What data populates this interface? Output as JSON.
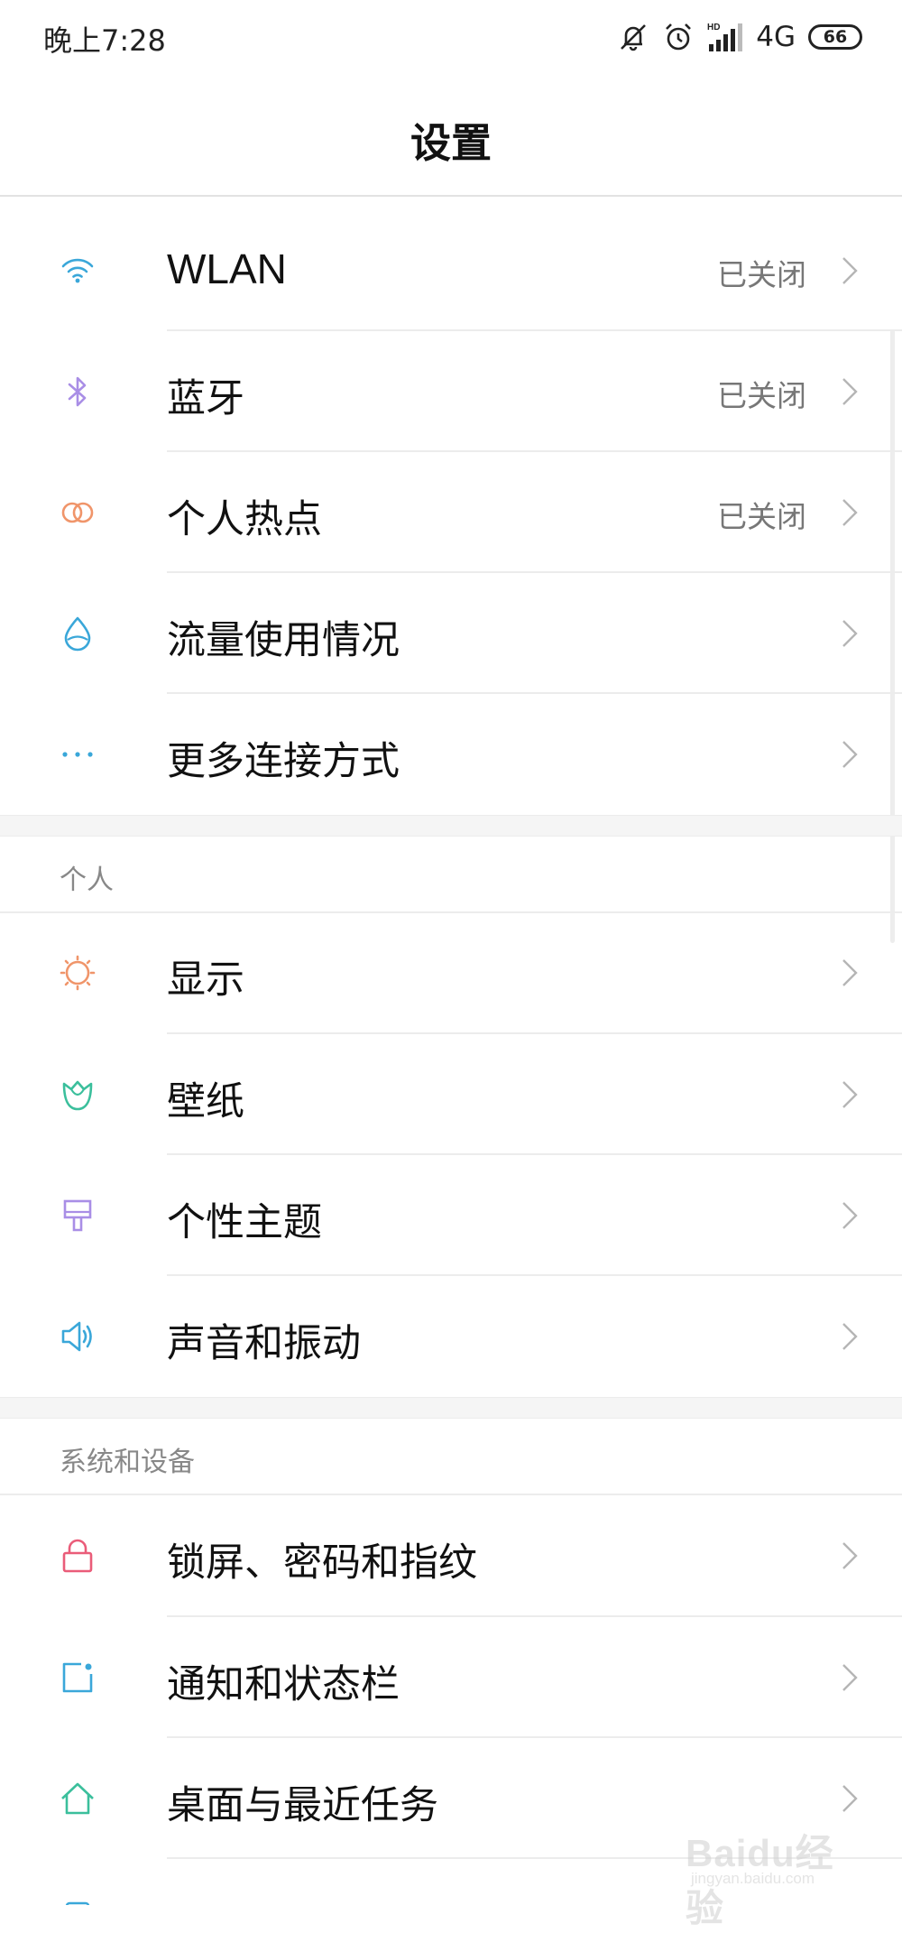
{
  "status_bar": {
    "time": "晚上7:28",
    "network": "4G",
    "battery": "66",
    "icons": [
      "mute-icon",
      "alarm-icon",
      "hd-signal-icon",
      "battery-icon"
    ]
  },
  "page": {
    "title": "设置"
  },
  "connections": [
    {
      "label": "WLAN",
      "value": "已关闭",
      "icon": "wifi-icon",
      "color": "#3aa7d9"
    },
    {
      "label": "蓝牙",
      "value": "已关闭",
      "icon": "bluetooth-icon",
      "color": "#a98ee6"
    },
    {
      "label": "个人热点",
      "value": "已关闭",
      "icon": "hotspot-icon",
      "color": "#f0956a"
    },
    {
      "label": "流量使用情况",
      "value": "",
      "icon": "data-usage-icon",
      "color": "#3aa7d9"
    },
    {
      "label": "更多连接方式",
      "value": "",
      "icon": "more-icon",
      "color": "#3aa7d9"
    }
  ],
  "personal": {
    "header": "个人",
    "items": [
      {
        "label": "显示",
        "icon": "display-icon",
        "color": "#f0956a"
      },
      {
        "label": "壁纸",
        "icon": "wallpaper-icon",
        "color": "#3bbf9c"
      },
      {
        "label": "个性主题",
        "icon": "theme-icon",
        "color": "#a98ee6"
      },
      {
        "label": "声音和振动",
        "icon": "sound-icon",
        "color": "#3aa7d9"
      }
    ]
  },
  "system": {
    "header": "系统和设备",
    "items": [
      {
        "label": "锁屏、密码和指纹",
        "icon": "lock-icon",
        "color": "#ea5c79"
      },
      {
        "label": "通知和状态栏",
        "icon": "notification-icon",
        "color": "#3aa7d9"
      },
      {
        "label": "桌面与最近任务",
        "icon": "home-icon",
        "color": "#3bbf9c"
      }
    ]
  },
  "watermark": {
    "text": "Baidu经验",
    "sub": "jingyan.baidu.com"
  }
}
